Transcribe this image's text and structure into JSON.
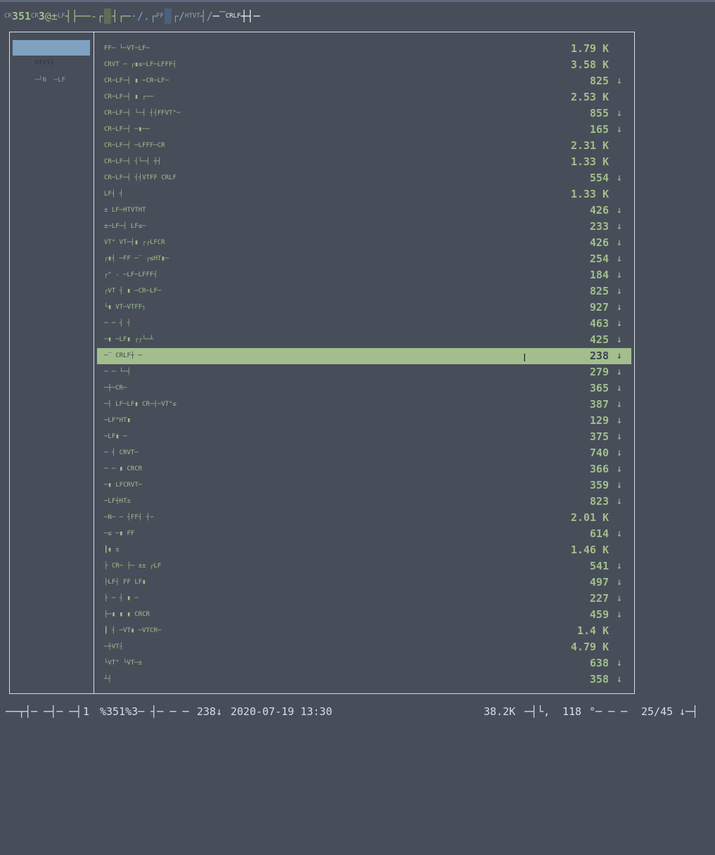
{
  "window": {
    "top_left_glyphs": "CR",
    "top_count": "351",
    "top_dim_1": "CR",
    "top_frag_1": "3",
    "top_frag_2": "@±",
    "top_dim_2": "LF",
    "top_glyphs_a": "┤├──",
    "top_glyphs_b": "-┌",
    "top_glyphs_c": "┤┌─",
    "top_path_blue_a": "·/.┌",
    "top_dim_3": "FF",
    "top_path_blue_b": "┌/",
    "top_dim_4": "HTVT",
    "top_path_blue_c": "┤/",
    "top_path_white": "─‾",
    "top_dim_5": "CRLF",
    "top_path_end": "┼┤─"
  },
  "sidebar": {
    "items": [
      {
        "label": "HTVT┼",
        "active": true
      },
      {
        "label": "─┘N  ─LF",
        "active": false
      }
    ]
  },
  "rows": [
    {
      "label": "FF─ └─VT─LF─",
      "size": "1.79 K",
      "arrow": ""
    },
    {
      "label": "CRVT ─ ┌▮≤─LF─LFFF┤",
      "size": "3.58 K",
      "arrow": ""
    },
    {
      "label": "CR─LF─┤ ▮ ─CR─LF─",
      "size": "825",
      "arrow": "↓"
    },
    {
      "label": "CR─LF─┤ ▮ ┌──",
      "size": "2.53 K",
      "arrow": ""
    },
    {
      "label": "CR─LF─┤ └─┤ ┤┤FFVT°─",
      "size": "855",
      "arrow": "↓"
    },
    {
      "label": "CR─LF─┤ ─▮──",
      "size": "165",
      "arrow": "↓"
    },
    {
      "label": "CR─LF─┤ ─LFFF─CR",
      "size": "2.31 K",
      "arrow": ""
    },
    {
      "label": "CR─LF─┤ ┤└─┤ ┼┤",
      "size": "1.33 K",
      "arrow": ""
    },
    {
      "label": "CR─LF─┤ ┤┤VTFF CRLF",
      "size": "554",
      "arrow": "↓"
    },
    {
      "label": "LF┤ ┤",
      "size": "1.33 K",
      "arrow": ""
    },
    {
      "label": "± LF─HTVTHT",
      "size": "426",
      "arrow": "↓"
    },
    {
      "label": "±─LF─┤ LF≤─",
      "size": "233",
      "arrow": "↓"
    },
    {
      "label": "VT° VT─┤▮ ┌┌LFCR",
      "size": "426",
      "arrow": "↓"
    },
    {
      "label": "┌▮┤ ─FF ─‾ ┌≤HT▮─",
      "size": "254",
      "arrow": "↓"
    },
    {
      "label": "┌° - ─LF─LFFF┤",
      "size": "184",
      "arrow": "↓"
    },
    {
      "label": "┌VT ┤ ▮ ─CR─LF─",
      "size": "825",
      "arrow": "↓"
    },
    {
      "label": "└▮ VT─VTFF┐",
      "size": "927",
      "arrow": "↓"
    },
    {
      "label": "─ ─ ┤ ┤",
      "size": "463",
      "arrow": "↓"
    },
    {
      "label": "─▮ ─LF▮ ┌┌└─┴",
      "size": "425",
      "arrow": "↓"
    },
    {
      "label": "─‾ CRLF┼ ─",
      "size": "238",
      "arrow": "↓"
    },
    {
      "label": "─ ─ └─┤",
      "size": "279",
      "arrow": "↓"
    },
    {
      "label": "─┼─CR─",
      "size": "365",
      "arrow": "↓"
    },
    {
      "label": "─┤ LF─LF▮ CR─┤─VT°≤",
      "size": "387",
      "arrow": "↓"
    },
    {
      "label": "─LF°HT▮",
      "size": "129",
      "arrow": "↓"
    },
    {
      "label": "─LF▮ ─",
      "size": "375",
      "arrow": "↓"
    },
    {
      "label": "─ ┤ CRVT─",
      "size": "740",
      "arrow": "↓"
    },
    {
      "label": "─ ─ ▮ CRCR",
      "size": "366",
      "arrow": "↓"
    },
    {
      "label": "─▮ LFCRVT─",
      "size": "359",
      "arrow": "↓"
    },
    {
      "label": "─LF┼HT±",
      "size": "823",
      "arrow": "↓"
    },
    {
      "label": "─N─ ─ ┤FF┤ ┤─",
      "size": "2.01 K",
      "arrow": ""
    },
    {
      "label": "─≤ ─▮ FF",
      "size": "614",
      "arrow": "↓"
    },
    {
      "label": "┃▮ ±",
      "size": "1.46 K",
      "arrow": ""
    },
    {
      "label": "├ CR─ ├─ ±± ┌LF",
      "size": "541",
      "arrow": "↓"
    },
    {
      "label": "├LF┤ FF LF▮",
      "size": "497",
      "arrow": "↓"
    },
    {
      "label": "├ ─ ┤ ▮ ─",
      "size": "227",
      "arrow": "↓"
    },
    {
      "label": "├─▮ ▮ ▮ CRCR",
      "size": "459",
      "arrow": "↓"
    },
    {
      "label": "┃ ┤ ─VT▮ ─VTCR─",
      "size": "1.4 K",
      "arrow": ""
    },
    {
      "label": "─┼VT┤",
      "size": "4.79 K",
      "arrow": ""
    },
    {
      "label": "└VT° └VT─±",
      "size": "638",
      "arrow": "↓"
    },
    {
      "label": "┴┤",
      "size": "358",
      "arrow": "↓"
    }
  ],
  "selected_index": 19,
  "status": {
    "left_glyphs": "──┬┤─ ─┤─ ─┤",
    "index": "1",
    "path": "%351%3─ ┤─ ─ ─",
    "size": "238↓",
    "datetime": "2020-07-19 13:30",
    "total": "38.2K",
    "glyph_mid": "─┤└,",
    "count": "118",
    "glyph_after": "°─ ─ ─",
    "position": "25/45",
    "end_glyph": "↓─┤"
  },
  "colors": {
    "background": "#474e59",
    "accent_green": "#a3be8c",
    "accent_blue": "#81a1c1",
    "border": "#d8dee9"
  }
}
